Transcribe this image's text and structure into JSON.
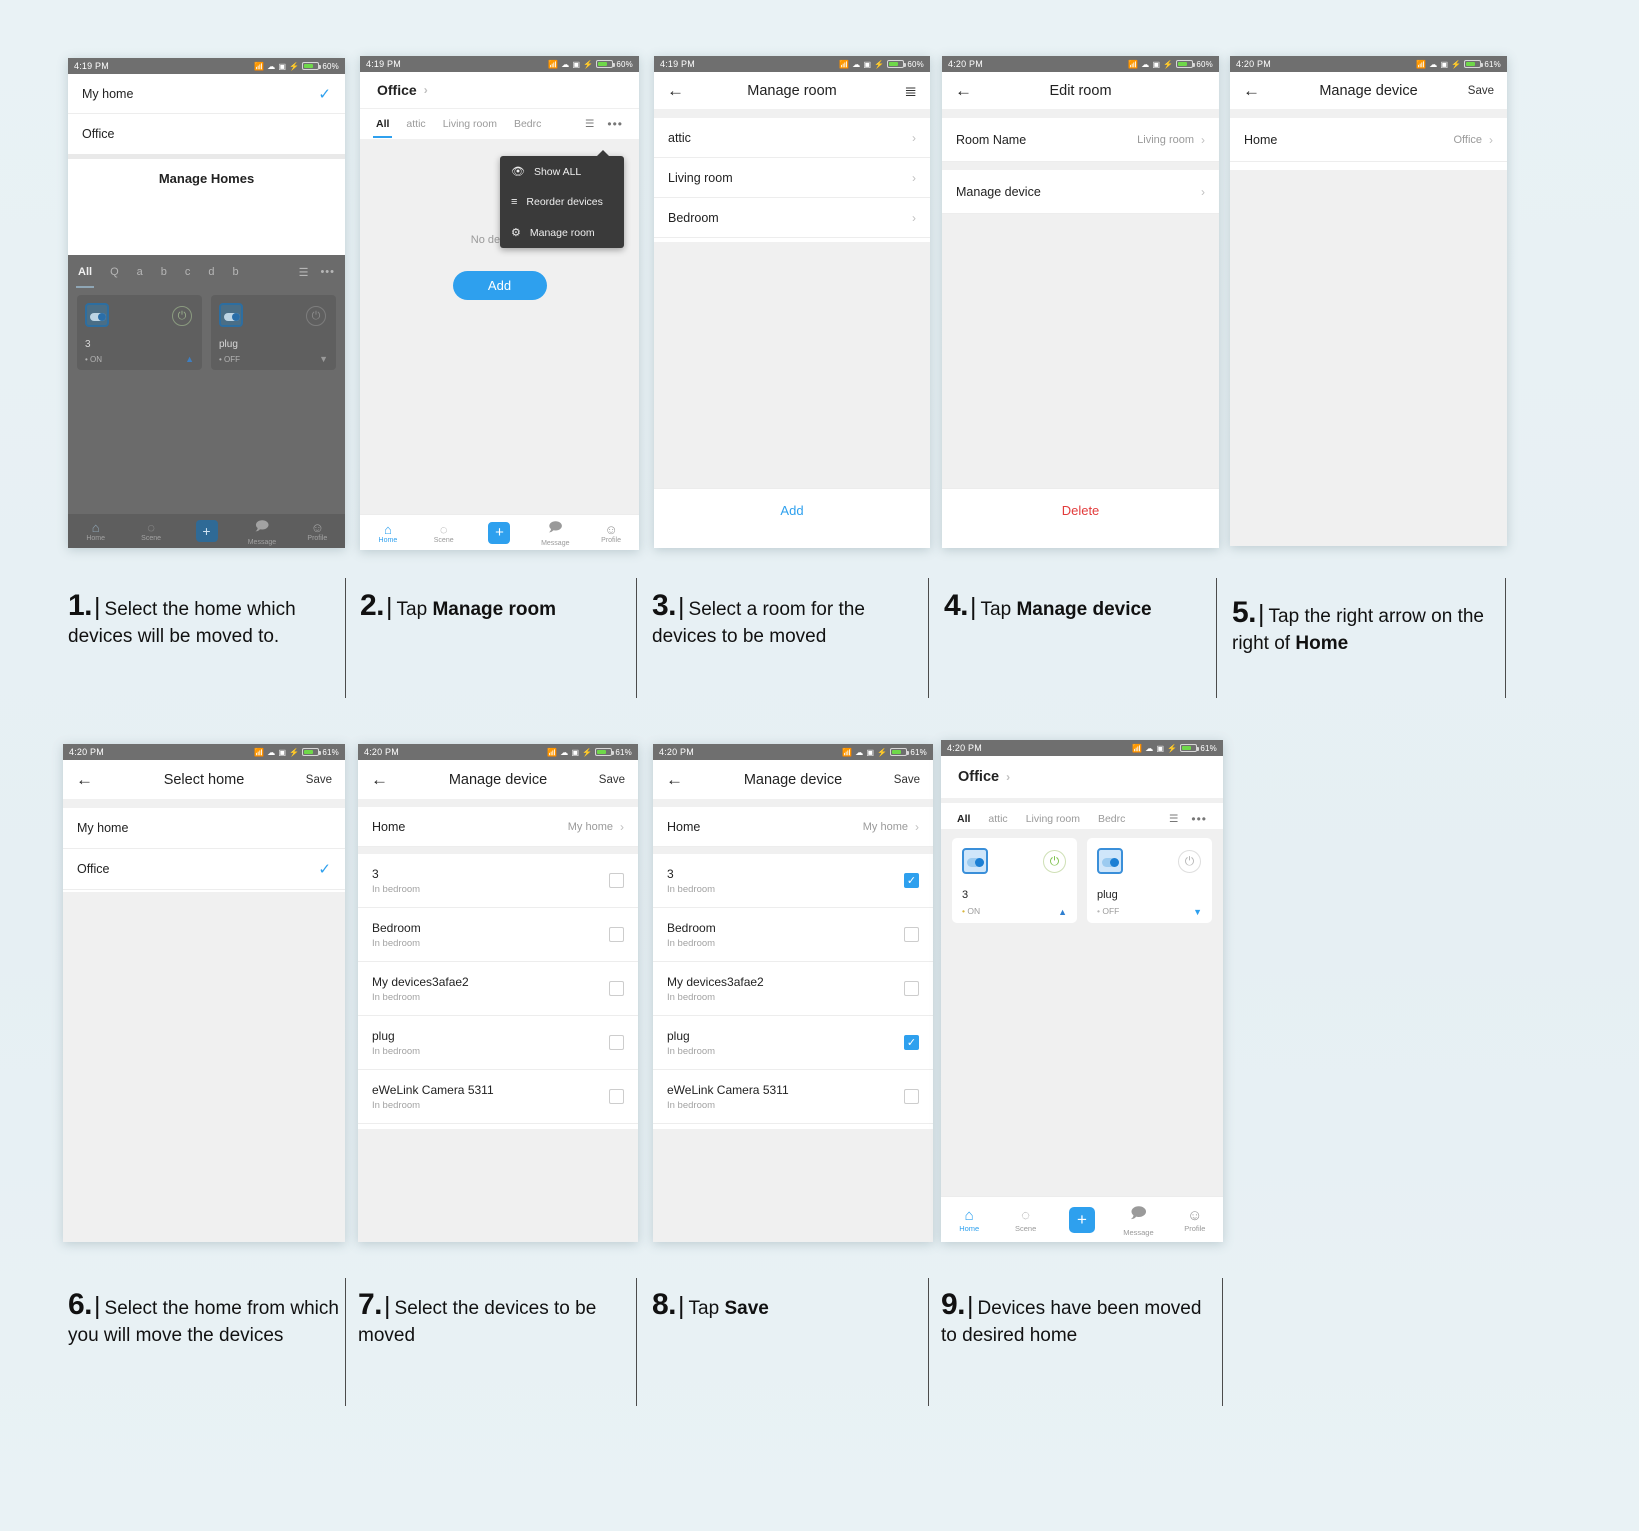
{
  "steps": [
    {
      "num": "1.",
      "text_before": "Select the home which devices will be moved to.",
      "bold": "",
      "text_after": ""
    },
    {
      "num": "2.",
      "text_before": "Tap ",
      "bold": "Manage room",
      "text_after": ""
    },
    {
      "num": "3.",
      "text_before": "Select a room for the devices to be moved",
      "bold": "",
      "text_after": ""
    },
    {
      "num": "4.",
      "text_before": "Tap ",
      "bold": "Manage device",
      "text_after": ""
    },
    {
      "num": "5.",
      "text_before": "Tap the right arrow on the right of ",
      "bold": "Home",
      "text_after": ""
    },
    {
      "num": "6.",
      "text_before": "Select the home from which you will move the devices",
      "bold": "",
      "text_after": ""
    },
    {
      "num": "7.",
      "text_before": "Select the devices to be moved",
      "bold": "",
      "text_after": ""
    },
    {
      "num": "8.",
      "text_before": "Tap ",
      "bold": "Save",
      "text_after": ""
    },
    {
      "num": "9.",
      "text_before": "Devices have been moved to desired home",
      "bold": "",
      "text_after": ""
    }
  ],
  "screen1": {
    "status": {
      "time": "4:19 PM",
      "battery": "60%"
    },
    "homes": [
      {
        "label": "My home",
        "selected": true
      },
      {
        "label": "Office",
        "selected": false
      }
    ],
    "manage_homes": "Manage Homes",
    "tabs": [
      "All",
      "Q",
      "a",
      "b",
      "c",
      "d",
      "b"
    ],
    "devices": [
      {
        "name": "3",
        "state": "ON"
      },
      {
        "name": "plug",
        "state": "OFF"
      }
    ],
    "nav": [
      "Home",
      "Scene",
      "Message",
      "Profile"
    ]
  },
  "screen2": {
    "status": {
      "time": "4:19 PM",
      "battery": "60%"
    },
    "home_title": "Office",
    "tabs": [
      "All",
      "attic",
      "Living room",
      "Bedrc"
    ],
    "empty_text": "No devices,",
    "add_button": "Add",
    "menu": [
      {
        "icon": "eye-icon",
        "label": "Show ALL"
      },
      {
        "icon": "reorder-icon",
        "label": "Reorder devices"
      },
      {
        "icon": "gear-icon",
        "label": "Manage room"
      }
    ],
    "nav": [
      "Home",
      "Scene",
      "Message",
      "Profile"
    ]
  },
  "screen3": {
    "status": {
      "time": "4:19 PM",
      "battery": "60%"
    },
    "title": "Manage room",
    "rooms": [
      "attic",
      "Living room",
      "Bedroom"
    ],
    "add_button": "Add"
  },
  "screen4": {
    "status": {
      "time": "4:20 PM",
      "battery": "60%"
    },
    "title": "Edit room",
    "rows": [
      {
        "label": "Room Name",
        "value": "Living room"
      },
      {
        "label": "Manage device",
        "value": ""
      }
    ],
    "delete_button": "Delete"
  },
  "screen5": {
    "status": {
      "time": "4:20 PM",
      "battery": "61%"
    },
    "title": "Manage device",
    "action": "Save",
    "rows": [
      {
        "label": "Home",
        "value": "Office"
      }
    ]
  },
  "screen6": {
    "status": {
      "time": "4:20 PM",
      "battery": "61%"
    },
    "title": "Select home",
    "action": "Save",
    "homes": [
      {
        "label": "My home",
        "selected": false
      },
      {
        "label": "Office",
        "selected": true
      }
    ]
  },
  "screen7": {
    "status": {
      "time": "4:20 PM",
      "battery": "61%"
    },
    "title": "Manage device",
    "action": "Save",
    "home_row": {
      "label": "Home",
      "value": "My home"
    },
    "devices": [
      {
        "name": "3",
        "sub": "In bedroom",
        "checked": false
      },
      {
        "name": "Bedroom",
        "sub": "In bedroom",
        "checked": false
      },
      {
        "name": "My devices3afae2",
        "sub": "In bedroom",
        "checked": false
      },
      {
        "name": "plug",
        "sub": "In bedroom",
        "checked": false
      },
      {
        "name": "eWeLink Camera 5311",
        "sub": "In bedroom",
        "checked": false
      }
    ]
  },
  "screen8": {
    "status": {
      "time": "4:20 PM",
      "battery": "61%"
    },
    "title": "Manage device",
    "action": "Save",
    "home_row": {
      "label": "Home",
      "value": "My home"
    },
    "devices": [
      {
        "name": "3",
        "sub": "In bedroom",
        "checked": true
      },
      {
        "name": "Bedroom",
        "sub": "In bedroom",
        "checked": false
      },
      {
        "name": "My devices3afae2",
        "sub": "In bedroom",
        "checked": false
      },
      {
        "name": "plug",
        "sub": "In bedroom",
        "checked": true
      },
      {
        "name": "eWeLink Camera 5311",
        "sub": "In bedroom",
        "checked": false
      }
    ]
  },
  "screen9": {
    "status": {
      "time": "4:20 PM",
      "battery": "61%"
    },
    "home_title": "Office",
    "tabs": [
      "All",
      "attic",
      "Living room",
      "Bedrc"
    ],
    "devices": [
      {
        "name": "3",
        "state": "ON",
        "on": true
      },
      {
        "name": "plug",
        "state": "OFF",
        "on": false
      }
    ],
    "nav": [
      "Home",
      "Scene",
      "Message",
      "Profile"
    ]
  },
  "colors": {
    "accent": "#2ea0ee",
    "statusbar": "#6f6f6f",
    "delete": "#e23b3b",
    "page_bg": "#e8f1f4"
  }
}
